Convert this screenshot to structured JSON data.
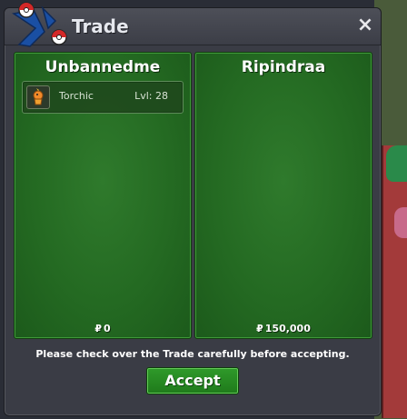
{
  "window": {
    "title": "Trade",
    "close_label": "×"
  },
  "left_panel": {
    "player_name": "Unbannedme",
    "money_symbol": "₽",
    "money": "0",
    "items": [
      {
        "name": "Torchic",
        "level": "Lvl: 28",
        "icon": "torchic-sprite-icon"
      }
    ]
  },
  "right_panel": {
    "player_name": "Ripindraa",
    "money_symbol": "₽",
    "money": "150,000"
  },
  "footer": {
    "notice": "Please check over the Trade carefully before accepting.",
    "accept_label": "Accept"
  },
  "colors": {
    "window_bg": "#3a3c45",
    "panel_green": "#246a22",
    "accept_green": "#2f9a2a"
  }
}
